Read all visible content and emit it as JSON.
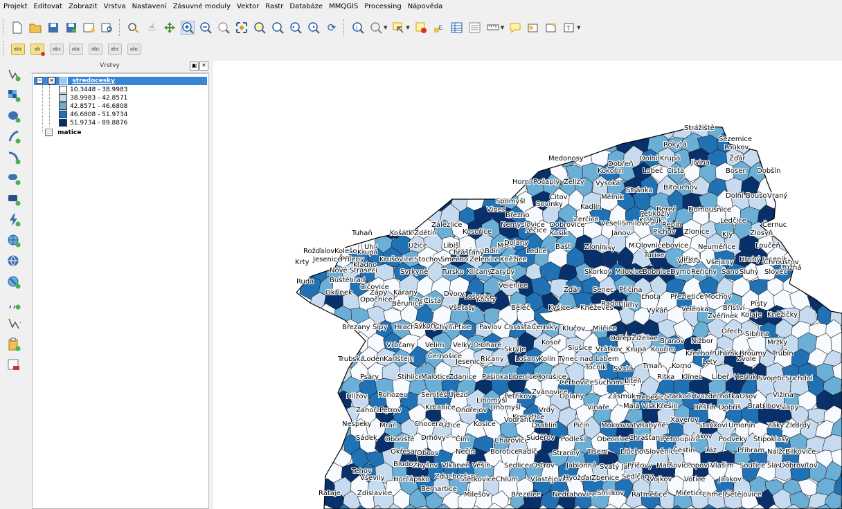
{
  "menu": [
    "Projekt",
    "Editovat",
    "Zobrazit",
    "Vrstva",
    "Nastavení",
    "Zásuvné moduly",
    "Vektor",
    "Rastr",
    "Databáze",
    "MMQGIS",
    "Processing",
    "Nápověda"
  ],
  "layers_panel": {
    "title": "Vrstvy",
    "layer1": {
      "name": "stredocesky",
      "classes": [
        {
          "label": "10.3448 - 38.9983",
          "color": "#f7fbff"
        },
        {
          "label": "38.9983 - 42.8571",
          "color": "#c6dbef"
        },
        {
          "label": "42.8571 - 46.6808",
          "color": "#6baed6"
        },
        {
          "label": "46.6808 - 51.9734",
          "color": "#2171b5"
        },
        {
          "label": "51.9734 - 89.8876",
          "color": "#08306b"
        }
      ]
    },
    "layer2": {
      "name": "matice"
    }
  },
  "map_labels": [
    "Strážiště",
    "Sezemice",
    "Rokytá",
    "Loukov",
    "Medonosy",
    "Dolní Krupá",
    "Jivina",
    "Žďár",
    "Dobřeň",
    "Kokořín",
    "Lobeč",
    "Čistá",
    "Bosen",
    "Dobšín",
    "Horní Počaply",
    "Želízy",
    "Vysoká",
    "Bitouchov",
    "Stránka",
    "Citov",
    "Mělník",
    "Kadlín",
    "Boreč",
    "Petikozly",
    "Dolní Bousov",
    "Vraný",
    "Spomyšl",
    "Sovínky",
    "Vinec",
    "Březno",
    "Domousnice",
    "Klobuky",
    "Ledčice",
    "Řepín",
    "Černuc",
    "Zálezlice",
    "Nemyslovice",
    "Dobrovice",
    "Zerčice",
    "Veselice",
    "Smilovice",
    "Plchov",
    "Zlonice",
    "Kly",
    "Zlosyň",
    "Tuhaň",
    "Košátky",
    "Zdětín",
    "Kosořice",
    "Pěčice",
    "Košík",
    "Janov",
    "Milý",
    "Libovice",
    "Neuměřice",
    "Uhy",
    "Užice",
    "Libiš",
    "Kroučová",
    "Bdín",
    "Mšec",
    "Ledce",
    "Olovnice",
    "Dřísy",
    "Vlkava",
    "Loučeň",
    "Rožďalovice",
    "Kolešov",
    "Krupá",
    "Chrášťany",
    "Dolany",
    "Bašť",
    "Zlonín",
    "Turice",
    "Jiřice",
    "Všejany",
    "Hrubý Jeseník",
    "Chroustov",
    "Krty",
    "Jesenice",
    "Přílepy",
    "Krušovice",
    "Stochov",
    "Smečno",
    "Zelenice",
    "Kněžice",
    "Lužná",
    "Nové Strašecí",
    "Kladno",
    "Svrkyně",
    "Tursko",
    "Klíčany",
    "Záryby",
    "Skorkov",
    "Milovice",
    "Bobnice",
    "Dymokury",
    "Řeřichy",
    "Šanov",
    "Sluhy",
    "Slověč",
    "Ruda",
    "Buštěhrad",
    "Číčovice",
    "Zápy",
    "Kárany",
    "Ostrá",
    "Dvory",
    "Kouty",
    "Velenice",
    "Žďár",
    "Senec",
    "Přičina",
    "Lhota",
    "Přezletice",
    "Mochov",
    "Bříství",
    "Písty",
    "Okřínek",
    "Opočnice",
    "Běrunice",
    "Čistá",
    "Všetaty",
    "Lašovice",
    "Běleč",
    "Kyšice",
    "Kněževes",
    "Radonice",
    "Jirny",
    "Vykáň",
    "Velenka",
    "Zvěřínek",
    "Kolaje",
    "Kněžičky",
    "Březany",
    "Šípy",
    "Hracholusky",
    "Sýkořice",
    "Chýňava",
    "Ptice",
    "Pavlov",
    "Chrášťany",
    "Černíky",
    "Klučov",
    "Milčice",
    "Odřepsy",
    "Žiželice",
    "Branov",
    "Nižbor",
    "Ořech",
    "Sibřina",
    "Mrzky",
    "Vrbčany",
    "Velim",
    "Velký Osek",
    "Oharé",
    "Skryje",
    "Kosoř",
    "Slušíce",
    "Vrátkov",
    "Krupá",
    "Kouřim",
    "Křečhoř",
    "Uhlířská Lhota",
    "Broumy",
    "Trubín",
    "Trubská",
    "Loděnice",
    "Karlštejn",
    "Černošice",
    "Jesenice",
    "Říčany",
    "Lošany",
    "Kolín",
    "Týnec nad Labem",
    "Točník",
    "Svatá",
    "Tmaň",
    "Korno",
    "Lety",
    "Zvole",
    "Psáry",
    "Štihlice",
    "Malotice",
    "Zdánice",
    "Pašinka",
    "Libenice",
    "Horušice",
    "Cerhovice",
    "Suchomasty",
    "Liteň",
    "Ritka",
    "Klínec",
    "Libeř",
    "Herink",
    "Svojetice",
    "Suchdol",
    "Hlízov",
    "Rohozec",
    "Semtěš",
    "Újezd",
    "Libomyšl",
    "Petříkov",
    "Zvánovice",
    "Oplany",
    "Zásmuky",
    "Třebešice",
    "Starkoč",
    "Hvozdec",
    "Lhotka",
    "Osov",
    "Vižina",
    "Zahořany",
    "Petrov",
    "Krhanice",
    "Ondřejov",
    "Onomyšl",
    "Kresetice",
    "Vrdy",
    "Vinaře",
    "Malá Víska",
    "Křešín",
    "Běštín",
    "Dobříš",
    "Bratřínov",
    "Slapy",
    "Nespeky",
    "Mrač",
    "Chocerady",
    "Užice",
    "Kosice",
    "Vodranty",
    "Drahlín",
    "Pičín",
    "Mokrovraty",
    "Rabyně",
    "Xaverov",
    "Staňkovice",
    "Úmonín",
    "Záky",
    "Žleby",
    "Brdy",
    "Sádek",
    "Oboriště",
    "Drhovy",
    "Čím",
    "Charovice",
    "Suděřov",
    "Podlesí",
    "Obecnice",
    "Chrášťany",
    "Petroupim",
    "Čakov",
    "Podveky",
    "Štipoklasy",
    "Okřesaneč",
    "Obcov",
    "Nečín",
    "Borotice",
    "Radíč",
    "Stranný",
    "Tisem",
    "Litichovice",
    "Slověnice",
    "Čestín",
    "Láz",
    "Příbram",
    "Nalžovice",
    "Bilkovice",
    "Tehov",
    "Bludov",
    "Zbyšov",
    "Vlkaneč",
    "Věšín",
    "Sedlice",
    "Ostrov",
    "Jablonná",
    "Svatý Jan",
    "Příčovy",
    "Maršovice",
    "Popovice",
    "Vlašim",
    "Soutice",
    "Slavošov",
    "Dobrovítov",
    "Vševily",
    "Horčápsko",
    "Zduchovice",
    "Štětkovice",
    "Chlum",
    "Vlastějovice",
    "Hvožďany",
    "Zbenice",
    "Sedlčany",
    "Vojkov",
    "Votice",
    "Jankov",
    "Rataje",
    "Zdislavice",
    "Bernartice",
    "Milešov",
    "Březnice",
    "Nedrahovice",
    "Smilkov",
    "Ratměřice",
    "Miřetice",
    "Chmelná",
    "Šetějovice"
  ]
}
